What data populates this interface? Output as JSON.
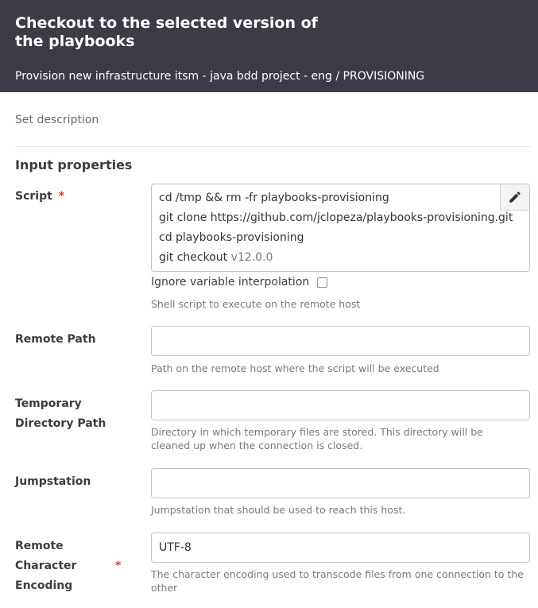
{
  "header": {
    "title": "Checkout to the selected version of the playbooks",
    "subtitle": "Provision new infrastructure itsm - java bdd project - eng / PROVISIONING"
  },
  "description_link": "Set description",
  "section_title": "Input properties",
  "required_mark": "*",
  "script": {
    "label": "Script",
    "lines": [
      "cd /tmp && rm -fr playbooks-provisioning",
      "git clone https://github.com/jclopeza/playbooks-provisioning.git",
      "cd playbooks-provisioning"
    ],
    "last_line_prefix": "git checkout ",
    "last_line_version": "v12.0.0",
    "edit_icon": "pencil-icon",
    "ignore_label": "Ignore variable interpolation",
    "ignore_checked": false,
    "help": "Shell script to execute on the remote host"
  },
  "remote_path": {
    "label": "Remote Path",
    "value": "",
    "help": "Path on the remote host where the script will be executed"
  },
  "temp_dir": {
    "label_line1": "Temporary",
    "label_line2": "Directory Path",
    "value": "",
    "help": "Directory in which temporary files are stored. This directory will be cleaned up when the connection is closed."
  },
  "jumpstation": {
    "label": "Jumpstation",
    "value": "",
    "help": "Jumpstation that should be used to reach this host."
  },
  "encoding": {
    "label_line1": "Remote",
    "label_line2": "Character",
    "label_line3": "Encoding",
    "value": "UTF-8",
    "help": "The character encoding used to transcode files from one connection to the other"
  },
  "colors": {
    "header_bg": "#3e3a46",
    "required": "#d33a2c"
  }
}
